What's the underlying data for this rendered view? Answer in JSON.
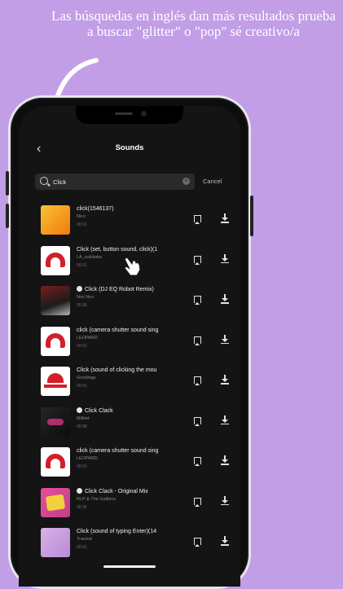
{
  "caption": {
    "text": "Las búsquedas en inglés dan más resultados prueba a buscar \"glitter\" o \"pop\" sé creativo/a"
  },
  "header": {
    "title": "Sounds",
    "back_icon": "chevron-left-icon"
  },
  "search": {
    "value": "Click",
    "icon": "search-icon",
    "clear_icon": "clear-icon",
    "cancel_label": "Cancel"
  },
  "sounds": [
    {
      "name": "click(1546137)",
      "artist": "Nico",
      "duration": "00:01",
      "verified": false,
      "thumb": "orange"
    },
    {
      "name": "Click (set, button sound, click)(1",
      "artist": "LA_sukikake",
      "duration": "00:01",
      "verified": false,
      "thumb": "red-logo"
    },
    {
      "name": "Click (DJ EQ Robot Remix)",
      "artist": "Nox Nox",
      "duration": "00:36",
      "verified": true,
      "thumb": "dj"
    },
    {
      "name": "click (camera shutter sound sing",
      "artist": "LEOPARD",
      "duration": "00:01",
      "verified": false,
      "thumb": "red-logo"
    },
    {
      "name": "Click (sound of clicking the mou",
      "artist": "Goodings",
      "duration": "00:01",
      "verified": false,
      "thumb": "red-logo-2"
    },
    {
      "name": "Click Clack",
      "artist": "Millitet",
      "duration": "00:58",
      "verified": true,
      "thumb": "dark"
    },
    {
      "name": "click (camera shutter sound sing",
      "artist": "LEOPARD",
      "duration": "00:01",
      "verified": false,
      "thumb": "red-logo"
    },
    {
      "name": "Click Clack - Original Mix",
      "artist": "RLP & The Galileos",
      "duration": "00:35",
      "verified": true,
      "thumb": "pink"
    },
    {
      "name": "Click (sound of typing Enter)(14",
      "artist": "Traumd",
      "duration": "00:01",
      "verified": false,
      "thumb": "lilac"
    }
  ],
  "row_icons": {
    "bookmark": "bookmark-icon",
    "download": "download-icon"
  },
  "overlay": {
    "hand": "pointing-hand-icon",
    "arrow": "curved-arrow"
  },
  "colors": {
    "background": "#c29ee6",
    "screen": "#141414",
    "accent_red": "#d31f2a"
  }
}
